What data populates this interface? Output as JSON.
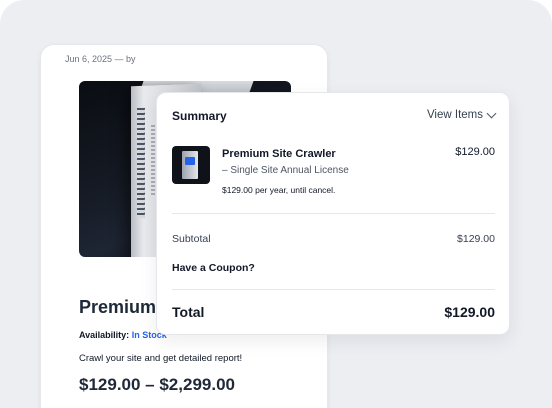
{
  "product_page": {
    "meta": "Jun 6, 2025 — by",
    "title": "Premium Site Crawler",
    "availability_label": "Availability:",
    "availability_value": "In Stock",
    "description": "Crawl your site and get detailed report!",
    "price_range": "$129.00 – $2,299.00"
  },
  "summary": {
    "heading": "Summary",
    "view_items": "View Items",
    "item": {
      "name": "Premium Site Crawler",
      "variant": "– Single Site Annual License",
      "recurring": "$129.00 per year, until cancel.",
      "price": "$129.00"
    },
    "subtotal_label": "Subtotal",
    "subtotal_value": "$129.00",
    "coupon_label": "Have a Coupon?",
    "total_label": "Total",
    "total_value": "$129.00"
  },
  "colors": {
    "background": "#eceef2",
    "link": "#2563eb",
    "text": "#111827"
  }
}
